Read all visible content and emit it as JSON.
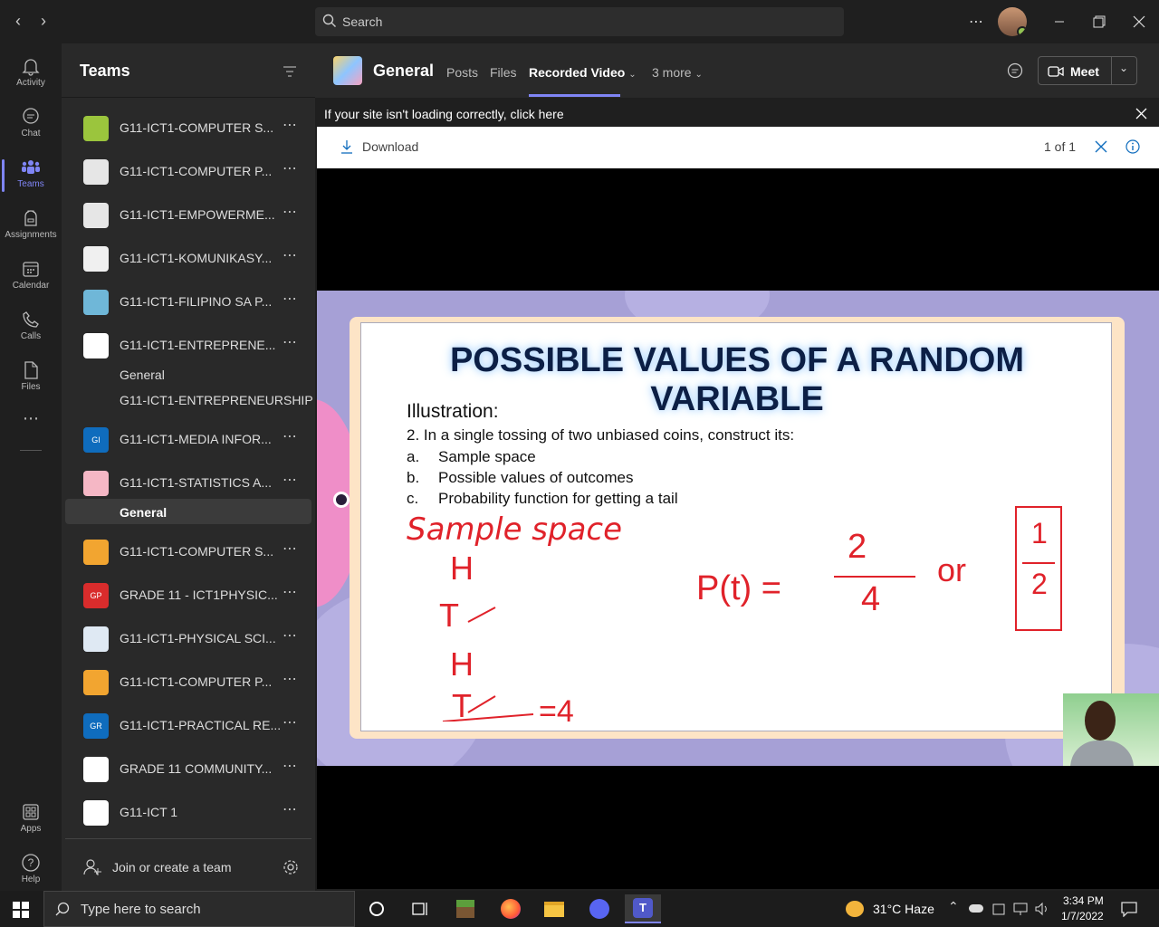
{
  "search": {
    "placeholder": "Search"
  },
  "rail": [
    {
      "label": "Activity",
      "icon": "bell-icon"
    },
    {
      "label": "Chat",
      "icon": "chat-icon"
    },
    {
      "label": "Teams",
      "icon": "teams-icon"
    },
    {
      "label": "Assignments",
      "icon": "backpack-icon"
    },
    {
      "label": "Calendar",
      "icon": "calendar-icon"
    },
    {
      "label": "Calls",
      "icon": "phone-icon"
    },
    {
      "label": "Files",
      "icon": "file-icon"
    },
    {
      "label": "Apps",
      "icon": "apps-icon"
    },
    {
      "label": "Help",
      "icon": "help-icon"
    }
  ],
  "panel": {
    "title": "Teams",
    "teams": [
      {
        "name": "G11-ICT1-COMPUTER S...",
        "logo_color": "#9bc53d",
        "logo_text": ""
      },
      {
        "name": "G11-ICT1-COMPUTER P...",
        "logo_color": "#e6e6e6",
        "logo_text": ""
      },
      {
        "name": "G11-ICT1-EMPOWERME...",
        "logo_color": "#e6e6e6",
        "logo_text": ""
      },
      {
        "name": "G11-ICT1-KOMUNIKASY...",
        "logo_color": "#f0f0f0",
        "logo_text": ""
      },
      {
        "name": "G11-ICT1-FILIPINO SA P...",
        "logo_color": "#6fb7d8",
        "logo_text": ""
      },
      {
        "name": "G11-ICT1-ENTREPRENE...",
        "logo_color": "#ffffff",
        "logo_text": ""
      },
      {
        "name": "G11-ICT1-MEDIA INFOR...",
        "logo_color": "#0f6cbd",
        "logo_text": "GI"
      },
      {
        "name": "G11-ICT1-STATISTICS A...",
        "logo_color": "#f5b7c5",
        "logo_text": ""
      },
      {
        "name": "G11-ICT1-COMPUTER S...",
        "logo_color": "#f2a530",
        "logo_text": ""
      },
      {
        "name": "GRADE 11 - ICT1PHYSIC...",
        "logo_color": "#d92c2c",
        "logo_text": "GP"
      },
      {
        "name": "G11-ICT1-PHYSICAL SCI...",
        "logo_color": "#dfe9f3",
        "logo_text": ""
      },
      {
        "name": "G11-ICT1-COMPUTER P...",
        "logo_color": "#f2a530",
        "logo_text": ""
      },
      {
        "name": "G11-ICT1-PRACTICAL RE...",
        "logo_color": "#0f6cbd",
        "logo_text": "GR"
      },
      {
        "name": "GRADE 11 COMMUNITY...",
        "logo_color": "#ffffff",
        "logo_text": ""
      },
      {
        "name": "G11-ICT 1",
        "logo_color": "#ffffff",
        "logo_text": ""
      }
    ],
    "entre_channels": [
      "General",
      "G11-ICT1-ENTREPRENEURSHIP"
    ],
    "stats_channel": "General",
    "join_label": "Join or create a team"
  },
  "channel": {
    "name": "General",
    "tabs": [
      "Posts",
      "Files",
      "Recorded Video",
      "3 more"
    ],
    "meet_label": "Meet"
  },
  "banner": {
    "text": "If your site isn't loading correctly, click here"
  },
  "viewer": {
    "download_label": "Download",
    "page_count": "1 of 1"
  },
  "slide": {
    "title": "POSSIBLE VALUES OF A RANDOM VARIABLE",
    "illustration": "Illustration:",
    "question": "2. In a single tossing of two unbiased coins, construct its:",
    "items": [
      {
        "letter": "a.",
        "text": "Sample space"
      },
      {
        "letter": "b.",
        "text": "Possible values of outcomes"
      },
      {
        "letter": "c.",
        "text": "Probability function for getting a tail"
      }
    ],
    "handwriting": {
      "heading": "Sample space",
      "outcomes": [
        "H",
        "T",
        "H",
        "T"
      ],
      "count": "=4",
      "formula": "P(t) =",
      "numerator": "2",
      "denominator": "4",
      "or": "or",
      "simplified_num": "1",
      "simplified_den": "2"
    }
  },
  "taskbar": {
    "search_placeholder": "Type here to search",
    "weather": "31°C  Haze",
    "time": "3:34 PM",
    "date": "1/7/2022"
  }
}
